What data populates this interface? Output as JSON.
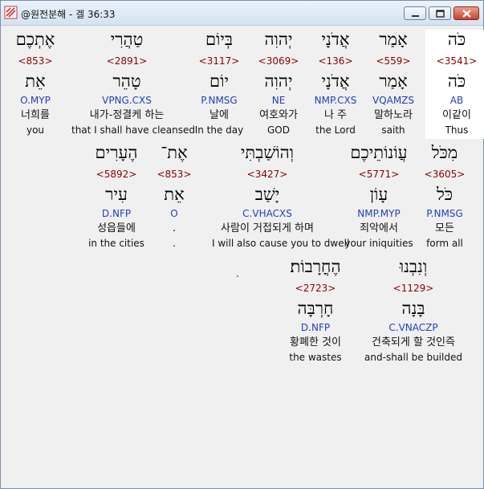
{
  "window": {
    "title": "@원전분해 - 겔 36:33"
  },
  "rows": [
    [
      {
        "heb": "כֹּה",
        "strong": "<3541>",
        "lex": "כֹּה",
        "parse": "AB",
        "kor": "이같이",
        "eng": "Thus",
        "selected": true
      },
      {
        "heb": "אָמַר",
        "strong": "<559>",
        "lex": "אָמַר",
        "parse": "VQAMZS",
        "kor": "말하노라",
        "eng": "saith"
      },
      {
        "heb": "אֲדֹנָי",
        "strong": "<136>",
        "lex": "אֲדֹנָי",
        "parse": "NMP.CXS",
        "kor": "나 주",
        "eng": "the Lord"
      },
      {
        "heb": "יְהוִה",
        "strong": "<3069>",
        "lex": "יְהוִה",
        "parse": "NE",
        "kor": "여호와가",
        "eng": "GOD"
      },
      {
        "heb": "בְּיוֹם",
        "strong": "<3117>",
        "lex": "יוֹם",
        "parse": "P.NMSG",
        "kor": "날에",
        "eng": "In the day"
      },
      {
        "heb": "טַהֲרִי",
        "strong": "<2891>",
        "lex": "טָהֵר",
        "parse": "VPNG.CXS",
        "kor": "내가-정결케 하는",
        "eng": "that I shall have cleansed"
      },
      {
        "heb": "אֶתְכֶם",
        "strong": "<853>",
        "lex": "אֵת",
        "parse": "O.MYP",
        "kor": "너희를",
        "eng": "you"
      }
    ],
    [
      {
        "heb": "מִכֹּל",
        "strong": "<3605>",
        "lex": "כֹּל",
        "parse": "P.NMSG",
        "kor": "모든",
        "eng": "form all"
      },
      {
        "heb": "עֲוֹנוֹתֵיכֶם",
        "strong": "<5771>",
        "lex": "עָוֹן",
        "parse": "NMP.MYP",
        "kor": "죄악에서",
        "eng": "your iniquities"
      },
      {
        "heb": "וְהוֹשַׁבְתִּי",
        "strong": "<3427>",
        "lex": "יָשַׁב",
        "parse": "C.VHACXS",
        "kor": "사람이 거접되게 하며",
        "eng": "I will also cause you to dwell"
      },
      {
        "heb": "אֶת־",
        "strong": "<853>",
        "lex": "אֵת",
        "parse": "O",
        "kor": ".",
        "eng": "."
      },
      {
        "heb": "הֶעָרִים",
        "strong": "<5892>",
        "lex": "עִיר",
        "parse": "D.NFP",
        "kor": "성읍들에",
        "eng": "in the cities"
      }
    ],
    [
      {
        "heb": "וְנִבְנוּ",
        "strong": "<1129>",
        "lex": "בָּנָה",
        "parse": "C.VNACZP",
        "kor": "건축되게 할 것인즉",
        "eng": "and-shall be builded"
      },
      {
        "heb": "הֶחֳרָבוֹת׃",
        "strong": "<2723>",
        "lex": "חָרְבָּה",
        "parse": "D.NFP",
        "kor": "황폐한 것이",
        "eng": "the wastes"
      }
    ]
  ]
}
